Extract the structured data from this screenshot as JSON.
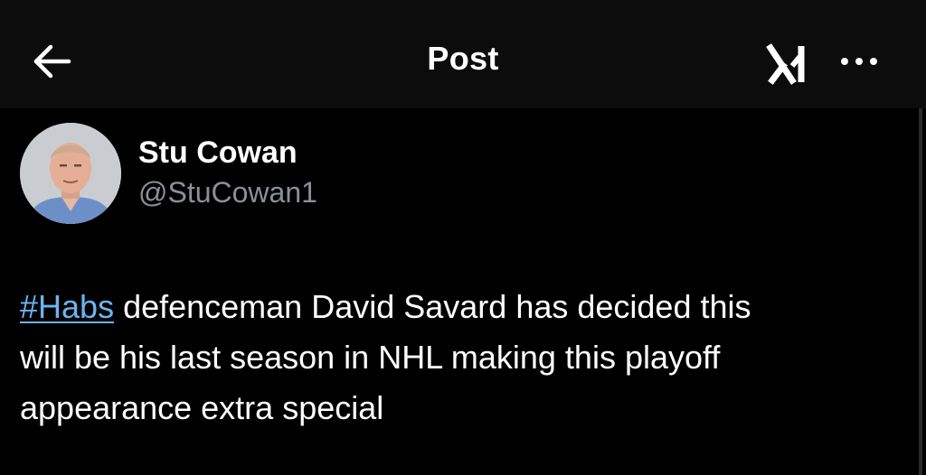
{
  "header": {
    "title": "Post",
    "back_icon": "arrow-left-icon",
    "grok_icon": "grok-icon",
    "more_icon": "more-horizontal-icon"
  },
  "author": {
    "display_name": "Stu Cowan",
    "handle": "@StuCowan1",
    "avatar_icon": "avatar-photo"
  },
  "post": {
    "hashtag": "#Habs",
    "line1_rest": " defenceman David Savard has decided this",
    "line2": "will be his last season in NHL making this playoff",
    "line3": "appearance extra special"
  },
  "colors": {
    "background": "#000000",
    "header_background": "#0c0c0c",
    "text": "#ffffff",
    "secondary_text": "#8b9096",
    "link": "#6cb4f2"
  }
}
